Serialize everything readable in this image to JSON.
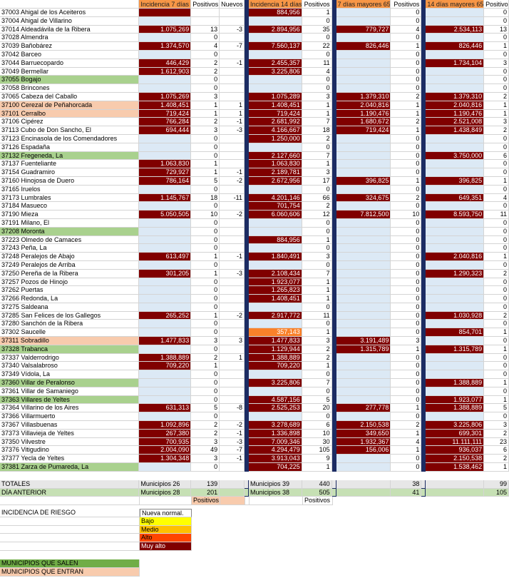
{
  "headers": {
    "i7": "Incidencia 7 días",
    "p7": "Positivos",
    "n7": "Nuevos",
    "i14": "Incidencia 14 días",
    "p14": "Positivos",
    "i65": "7 días mayores 65",
    "p65": "Positivos",
    "i1465": "14 días mayores 65",
    "p1465": "Positivos"
  },
  "rows": [
    [
      "37003 Ahigal de los Aceiteros",
      "",
      "",
      "",
      "884,956",
      "1",
      "",
      "0",
      "",
      "0",
      "",
      "d",
      "",
      "d",
      "",
      "",
      ""
    ],
    [
      "37004 Ahigal de Villarino",
      "",
      "",
      "",
      "",
      "0",
      "",
      "0",
      "",
      "0",
      "",
      "",
      "",
      "",
      "",
      "",
      ""
    ],
    [
      "37014 Aldeadávila de la Ribera",
      "1.075,269",
      "13",
      "-3",
      "2.894,956",
      "35",
      "779,727",
      "4",
      "2.534,113",
      "13",
      "",
      "d",
      "",
      "d",
      "d",
      "d",
      ""
    ],
    [
      "37028 Almendra",
      "",
      "0",
      "",
      "",
      "0",
      "",
      "0",
      "",
      "0",
      "",
      "",
      "",
      "",
      "",
      "",
      ""
    ],
    [
      "37039 Bañobárez",
      "1.374,570",
      "4",
      "-7",
      "7.560,137",
      "22",
      "826,446",
      "1",
      "826,446",
      "1",
      "",
      "d",
      "",
      "d",
      "d",
      "d",
      ""
    ],
    [
      "37042 Barceo",
      "",
      "0",
      "",
      "",
      "0",
      "",
      "0",
      "",
      "0",
      "",
      "",
      "",
      "",
      "",
      "",
      ""
    ],
    [
      "37044 Barruecopardo",
      "446,429",
      "2",
      "-1",
      "2.455,357",
      "11",
      "",
      "0",
      "1.734,104",
      "3",
      "",
      "d",
      "",
      "d",
      "",
      "d",
      ""
    ],
    [
      "37049 Bermellar",
      "1.612,903",
      "2",
      "",
      "3.225,806",
      "4",
      "",
      "0",
      "",
      "0",
      "",
      "d",
      "",
      "d",
      "",
      "",
      ""
    ],
    [
      "37055 Bogajo",
      "",
      "0",
      "",
      "",
      "0",
      "",
      "0",
      "",
      "0",
      "gn",
      "",
      "",
      "",
      "",
      "",
      ""
    ],
    [
      "37058 Brincones",
      "",
      "0",
      "",
      "",
      "0",
      "",
      "0",
      "",
      "0",
      "",
      "",
      "",
      "",
      "",
      "",
      ""
    ],
    [
      "37065 Cabeza del Caballo",
      "1.075,269",
      "3",
      "",
      "1.075,289",
      "3",
      "1.379,310",
      "2",
      "1.379,310",
      "2",
      "",
      "d",
      "",
      "d",
      "d",
      "d",
      ""
    ],
    [
      "37100 Cerezal de Peñahorcada",
      "1.408,451",
      "1",
      "1",
      "1.408,451",
      "1",
      "2.040,816",
      "1",
      "2.040,816",
      "1",
      "pk",
      "d",
      "",
      "d",
      "d",
      "d",
      ""
    ],
    [
      "37101 Cerralbo",
      "719,424",
      "1",
      "1",
      "719,424",
      "1",
      "1.190,476",
      "1",
      "1.190,476",
      "1",
      "pk",
      "d",
      "",
      "d",
      "d",
      "d",
      ""
    ],
    [
      "37106 Cipérez",
      "766,284",
      "2",
      "-1",
      "2.681,992",
      "7",
      "1.680,672",
      "2",
      "2.521,008",
      "3",
      "",
      "d",
      "",
      "d",
      "d",
      "d",
      ""
    ],
    [
      "37113 Cubo de Don Sancho, El",
      "694,444",
      "3",
      "-3",
      "4.166,667",
      "18",
      "719,424",
      "1",
      "1.438,849",
      "2",
      "",
      "d",
      "",
      "d",
      "d",
      "d",
      ""
    ],
    [
      "37123 Encinasola de los Comendadores",
      "",
      "0",
      "",
      "1.250,000",
      "2",
      "",
      "0",
      "",
      "0",
      "",
      "",
      "",
      "d",
      "",
      "",
      ""
    ],
    [
      "37126 Espadaña",
      "",
      "0",
      "",
      "",
      "0",
      "",
      "0",
      "",
      "0",
      "",
      "",
      "",
      "",
      "",
      "",
      ""
    ],
    [
      "37132 Fregeneda, La",
      "",
      "0",
      "",
      "2.127,660",
      "7",
      "",
      "0",
      "3.750,000",
      "6",
      "gn",
      "",
      "",
      "d",
      "",
      "d",
      ""
    ],
    [
      "37137 Fuenteliante",
      "1.063,830",
      "1",
      "",
      "1.063,830",
      "1",
      "",
      "0",
      "",
      "0",
      "",
      "d",
      "",
      "d",
      "",
      "",
      ""
    ],
    [
      "37154 Guadramiro",
      "729,927",
      "1",
      "-1",
      "2.189,781",
      "3",
      "",
      "0",
      "",
      "0",
      "",
      "d",
      "",
      "d",
      "",
      "",
      ""
    ],
    [
      "37160 Hinojosa de Duero",
      "786,164",
      "5",
      "-2",
      "2.672,956",
      "17",
      "396,825",
      "1",
      "396,825",
      "1",
      "",
      "d",
      "",
      "d",
      "d",
      "d",
      ""
    ],
    [
      "37165 Iruelos",
      "",
      "0",
      "",
      "",
      "0",
      "",
      "0",
      "",
      "0",
      "",
      "",
      "",
      "",
      "",
      "",
      ""
    ],
    [
      "37173 Lumbrales",
      "1.145,767",
      "18",
      "-11",
      "4.201,146",
      "66",
      "324,675",
      "2",
      "649,351",
      "4",
      "",
      "d",
      "",
      "d",
      "d",
      "d",
      ""
    ],
    [
      "37184 Masueco",
      "",
      "0",
      "",
      "701,754",
      "2",
      "",
      "0",
      "",
      "0",
      "",
      "",
      "",
      "d",
      "",
      "",
      ""
    ],
    [
      "37190 Mieza",
      "5.050,505",
      "10",
      "-2",
      "6.060,606",
      "12",
      "7.812,500",
      "10",
      "8.593,750",
      "11",
      "",
      "d",
      "",
      "d",
      "d",
      "d",
      ""
    ],
    [
      "37191 Milano, El",
      "",
      "0",
      "",
      "",
      "0",
      "",
      "0",
      "",
      "0",
      "",
      "",
      "",
      "",
      "",
      "",
      ""
    ],
    [
      "37208 Moronta",
      "",
      "0",
      "",
      "",
      "0",
      "",
      "0",
      "",
      "0",
      "gn",
      "",
      "",
      "",
      "",
      "",
      ""
    ],
    [
      "37223 Olmedo de Camaces",
      "",
      "0",
      "",
      "884,956",
      "1",
      "",
      "0",
      "",
      "0",
      "",
      "",
      "",
      "d",
      "",
      "",
      ""
    ],
    [
      "37243 Peña, La",
      "",
      "0",
      "",
      "",
      "0",
      "",
      "0",
      "",
      "0",
      "",
      "",
      "",
      "",
      "",
      "",
      ""
    ],
    [
      "37248 Peralejos de Abajo",
      "613,497",
      "1",
      "-1",
      "1.840,491",
      "3",
      "",
      "0",
      "2.040,816",
      "1",
      "",
      "d",
      "",
      "d",
      "",
      "d",
      ""
    ],
    [
      "37249 Peralejos de Arriba",
      "",
      "0",
      "",
      "",
      "0",
      "",
      "0",
      "",
      "0",
      "",
      "",
      "",
      "",
      "",
      "",
      ""
    ],
    [
      "37250 Pereña de la Ribera",
      "301,205",
      "1",
      "-3",
      "2.108,434",
      "7",
      "",
      "0",
      "1.290,323",
      "2",
      "",
      "d",
      "",
      "d",
      "",
      "d",
      ""
    ],
    [
      "37257 Pozos de Hinojo",
      "",
      "0",
      "",
      "1.923,077",
      "1",
      "",
      "0",
      "",
      "0",
      "",
      "",
      "",
      "d",
      "",
      "",
      ""
    ],
    [
      "37262 Puertas",
      "",
      "0",
      "",
      "1.265,823",
      "1",
      "",
      "0",
      "",
      "0",
      "",
      "",
      "",
      "d",
      "",
      "",
      ""
    ],
    [
      "37266 Redonda, La",
      "",
      "0",
      "",
      "1.408,451",
      "1",
      "",
      "0",
      "",
      "0",
      "",
      "",
      "",
      "d",
      "",
      "",
      ""
    ],
    [
      "37275 Saldeana",
      "",
      "0",
      "",
      "",
      "0",
      "",
      "0",
      "",
      "0",
      "",
      "",
      "",
      "",
      "",
      "",
      ""
    ],
    [
      "37285 San Felices de los Gallegos",
      "265,252",
      "1",
      "-2",
      "2.917,772",
      "11",
      "",
      "0",
      "1.030,928",
      "2",
      "",
      "d",
      "",
      "d",
      "",
      "d",
      ""
    ],
    [
      "37280 Sanchón de la Ribera",
      "",
      "0",
      "",
      "",
      "0",
      "",
      "0",
      "",
      "0",
      "",
      "",
      "",
      "",
      "",
      "",
      ""
    ],
    [
      "37302 Saucelle",
      "",
      "0",
      "",
      "357,143",
      "1",
      "",
      "0",
      "854,701",
      "1",
      "",
      "",
      "",
      "o",
      "",
      "d",
      ""
    ],
    [
      "37311 Sobradillo",
      "1.477,833",
      "3",
      "3",
      "1.477,833",
      "3",
      "3.191,489",
      "3",
      "",
      "0",
      "pk",
      "d",
      "",
      "d",
      "d",
      "",
      ""
    ],
    [
      "37328 Trabanca",
      "",
      "0",
      "",
      "1.129,944",
      "2",
      "1.315,789",
      "1",
      "1.315,789",
      "1",
      "gn",
      "",
      "",
      "d",
      "d",
      "d",
      ""
    ],
    [
      "37337 Valderrodrigo",
      "1.388,889",
      "2",
      "1",
      "1.388,889",
      "2",
      "",
      "0",
      "",
      "0",
      "",
      "d",
      "",
      "d",
      "",
      "",
      ""
    ],
    [
      "37340 Valsalabroso",
      "709,220",
      "1",
      "",
      "709,220",
      "1",
      "",
      "0",
      "",
      "0",
      "",
      "d",
      "",
      "d",
      "",
      "",
      ""
    ],
    [
      "37349 Vídola, La",
      "",
      "0",
      "",
      "",
      "0",
      "",
      "0",
      "",
      "0",
      "",
      "",
      "",
      "",
      "",
      "",
      ""
    ],
    [
      "37360 Villar de Peralonso",
      "",
      "0",
      "",
      "3.225,806",
      "7",
      "",
      "0",
      "1.388,889",
      "1",
      "gn",
      "",
      "",
      "d",
      "",
      "d",
      ""
    ],
    [
      "37361 Villar de Samaniego",
      "",
      "0",
      "",
      "",
      "0",
      "",
      "0",
      "",
      "0",
      "",
      "",
      "",
      "",
      "",
      "",
      ""
    ],
    [
      "37363 Villares de Yeltes",
      "",
      "0",
      "",
      "4.587,156",
      "5",
      "",
      "0",
      "1.923,077",
      "1",
      "gn",
      "",
      "",
      "d",
      "",
      "d",
      ""
    ],
    [
      "37364 Villarino de los Aires",
      "631,313",
      "5",
      "-8",
      "2.525,253",
      "20",
      "277,778",
      "1",
      "1.388,889",
      "5",
      "",
      "d",
      "",
      "d",
      "d",
      "d",
      ""
    ],
    [
      "37366 Villarmuerto",
      "",
      "0",
      "",
      "",
      "0",
      "",
      "0",
      "",
      "0",
      "",
      "",
      "",
      "",
      "",
      "",
      ""
    ],
    [
      "37367 Villasbuenas",
      "1.092,896",
      "2",
      "-2",
      "3.278,689",
      "6",
      "2.150,538",
      "2",
      "3.225,806",
      "3",
      "",
      "d",
      "",
      "d",
      "d",
      "d",
      ""
    ],
    [
      "37373 Villavieja de Yeltes",
      "267,380",
      "2",
      "-1",
      "1.336,898",
      "10",
      "349,650",
      "1",
      "699,301",
      "2",
      "",
      "d",
      "",
      "d",
      "d",
      "d",
      ""
    ],
    [
      "37350 Vilvestre",
      "700,935",
      "3",
      "-3",
      "7.009,346",
      "30",
      "1.932,367",
      "4",
      "11.111,111",
      "23",
      "",
      "d",
      "",
      "d",
      "d",
      "d",
      ""
    ],
    [
      "37376 Vitigudino",
      "2.004,090",
      "49",
      "-7",
      "4.294,479",
      "105",
      "156,006",
      "1",
      "936,037",
      "6",
      "",
      "d",
      "",
      "d",
      "d",
      "d",
      ""
    ],
    [
      "37377 Yecla de Yeltes",
      "1.304,348",
      "3",
      "-1",
      "3.913,043",
      "9",
      "",
      "0",
      "2.150,538",
      "2",
      "",
      "d",
      "",
      "d",
      "",
      "d",
      ""
    ],
    [
      "37381 Zarza de Pumareda, La",
      "",
      "0",
      "",
      "704,225",
      "1",
      "",
      "0",
      "1.538,462",
      "1",
      "gn",
      "",
      "",
      "d",
      "",
      "d",
      ""
    ]
  ],
  "totals": {
    "label": "TOTALES",
    "m7": "Municipios 26",
    "p7": "139",
    "m14": "Municipios 39",
    "p14": "440",
    "p65": "38",
    "p1465": "99"
  },
  "anterior": {
    "label": "DÍA ANTERIOR",
    "m7": "Municipios 28",
    "p7": "201",
    "m14": "Municipios 38",
    "p14": "505",
    "p65": "41",
    "p1465": "105"
  },
  "positivos_label1": "Positivos",
  "positivos_label2": "Positivos",
  "legend": {
    "title": "INCIDENCIA DE RIESGO",
    "items": [
      "Nueva normal.",
      "Bajo",
      "Medio",
      "Alto",
      "Muy alto"
    ]
  },
  "salen": "MUNICIPIOS QUE SALEN",
  "entran": "MUNICIPIOS QUE ENTRAN",
  "colors": {
    "dark_red": "#800000",
    "orange": "#f9812a",
    "light_blue": "#dce9f5",
    "green": "#a9d18e",
    "pink": "#f8cbad",
    "header_orange": "#f79646",
    "separator_navy": "#1c2c63"
  }
}
